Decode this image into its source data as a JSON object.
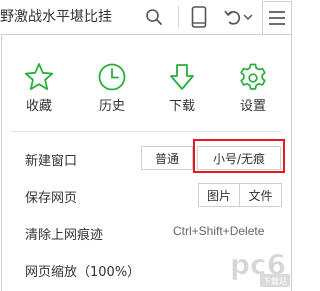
{
  "header": {
    "page_title": "野激战水平堪比挂"
  },
  "quick_actions": [
    {
      "icon": "star-icon",
      "label": "收藏"
    },
    {
      "icon": "clock-icon",
      "label": "历史"
    },
    {
      "icon": "download-arrow-icon",
      "label": "下载"
    },
    {
      "icon": "gear-icon",
      "label": "设置"
    }
  ],
  "menu": {
    "new_window": {
      "label": "新建窗口",
      "options": [
        "普通",
        "小号/无痕"
      ]
    },
    "save_page": {
      "label": "保存网页",
      "options": [
        "图片",
        "文件"
      ]
    },
    "clear_history": {
      "label": "清除上网痕迹",
      "shortcut": "Ctrl+Shift+Delete"
    },
    "zoom": {
      "label": "网页缩放（100%）"
    }
  },
  "watermark": {
    "text": "pc6",
    "sub": "下载站"
  },
  "colors": {
    "accent_green": "#2aae3e",
    "highlight_red": "#e8181e"
  }
}
